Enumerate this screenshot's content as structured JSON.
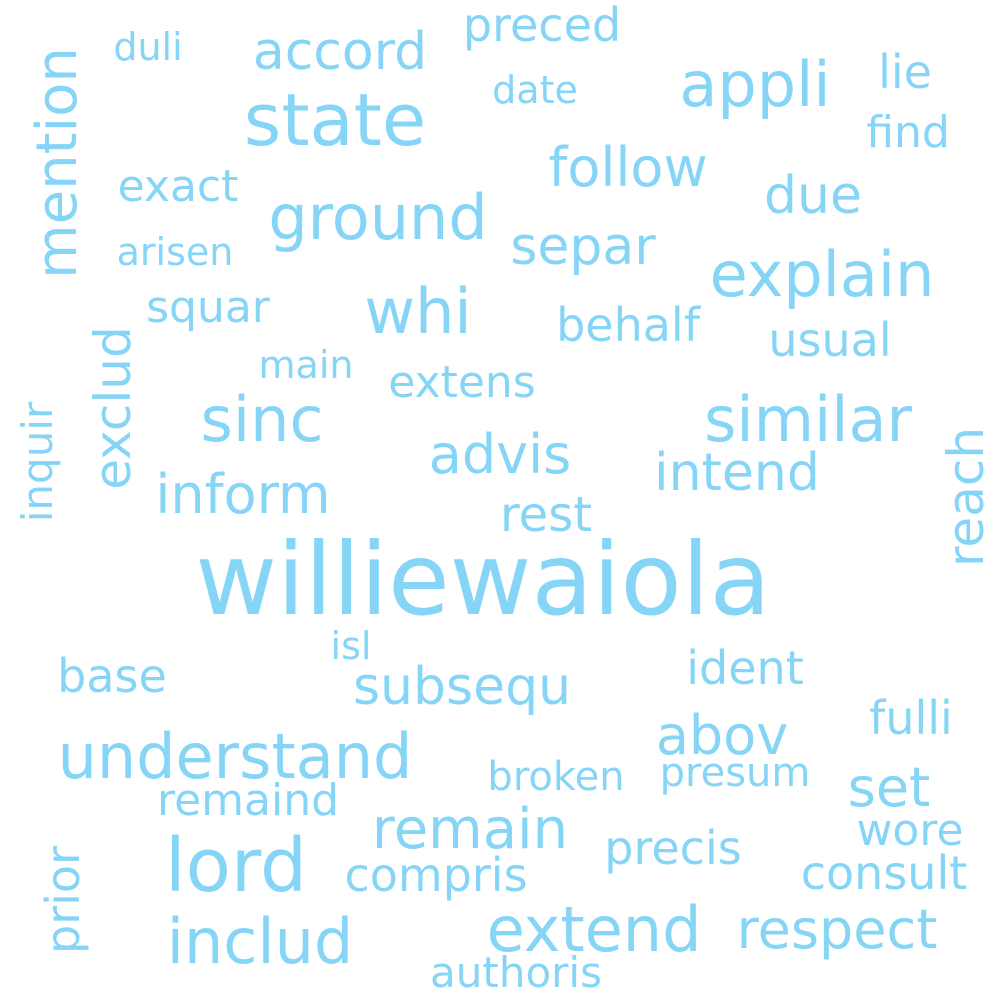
{
  "word_cloud": {
    "color": "#86d5f7",
    "words": [
      {
        "text": "williewaiola",
        "orientation": "horizontal"
      },
      {
        "text": "state",
        "orientation": "horizontal"
      },
      {
        "text": "accord",
        "orientation": "horizontal"
      },
      {
        "text": "preced",
        "orientation": "horizontal"
      },
      {
        "text": "duli",
        "orientation": "horizontal"
      },
      {
        "text": "appli",
        "orientation": "horizontal"
      },
      {
        "text": "lie",
        "orientation": "horizontal"
      },
      {
        "text": "date",
        "orientation": "horizontal"
      },
      {
        "text": "find",
        "orientation": "horizontal"
      },
      {
        "text": "mention",
        "orientation": "vertical"
      },
      {
        "text": "follow",
        "orientation": "horizontal"
      },
      {
        "text": "exact",
        "orientation": "horizontal"
      },
      {
        "text": "due",
        "orientation": "horizontal"
      },
      {
        "text": "ground",
        "orientation": "horizontal"
      },
      {
        "text": "separ",
        "orientation": "horizontal"
      },
      {
        "text": "explain",
        "orientation": "horizontal"
      },
      {
        "text": "arisen",
        "orientation": "horizontal"
      },
      {
        "text": "whi",
        "orientation": "horizontal"
      },
      {
        "text": "squar",
        "orientation": "horizontal"
      },
      {
        "text": "behalf",
        "orientation": "horizontal"
      },
      {
        "text": "usual",
        "orientation": "horizontal"
      },
      {
        "text": "exclud",
        "orientation": "vertical"
      },
      {
        "text": "main",
        "orientation": "horizontal"
      },
      {
        "text": "extens",
        "orientation": "horizontal"
      },
      {
        "text": "inquir",
        "orientation": "vertical"
      },
      {
        "text": "sinc",
        "orientation": "horizontal"
      },
      {
        "text": "similar",
        "orientation": "horizontal"
      },
      {
        "text": "reach",
        "orientation": "vertical"
      },
      {
        "text": "advis",
        "orientation": "horizontal"
      },
      {
        "text": "intend",
        "orientation": "horizontal"
      },
      {
        "text": "inform",
        "orientation": "horizontal"
      },
      {
        "text": "rest",
        "orientation": "horizontal"
      },
      {
        "text": "isl",
        "orientation": "horizontal"
      },
      {
        "text": "base",
        "orientation": "horizontal"
      },
      {
        "text": "subsequ",
        "orientation": "horizontal"
      },
      {
        "text": "ident",
        "orientation": "horizontal"
      },
      {
        "text": "fulli",
        "orientation": "horizontal"
      },
      {
        "text": "abov",
        "orientation": "horizontal"
      },
      {
        "text": "understand",
        "orientation": "horizontal"
      },
      {
        "text": "broken",
        "orientation": "horizontal"
      },
      {
        "text": "presum",
        "orientation": "horizontal"
      },
      {
        "text": "set",
        "orientation": "horizontal"
      },
      {
        "text": "remaind",
        "orientation": "horizontal"
      },
      {
        "text": "remain",
        "orientation": "horizontal"
      },
      {
        "text": "wore",
        "orientation": "horizontal"
      },
      {
        "text": "prior",
        "orientation": "vertical"
      },
      {
        "text": "lord",
        "orientation": "horizontal"
      },
      {
        "text": "precis",
        "orientation": "horizontal"
      },
      {
        "text": "compris",
        "orientation": "horizontal"
      },
      {
        "text": "consult",
        "orientation": "horizontal"
      },
      {
        "text": "includ",
        "orientation": "horizontal"
      },
      {
        "text": "extend",
        "orientation": "horizontal"
      },
      {
        "text": "respect",
        "orientation": "horizontal"
      },
      {
        "text": "authoris",
        "orientation": "horizontal"
      }
    ]
  }
}
